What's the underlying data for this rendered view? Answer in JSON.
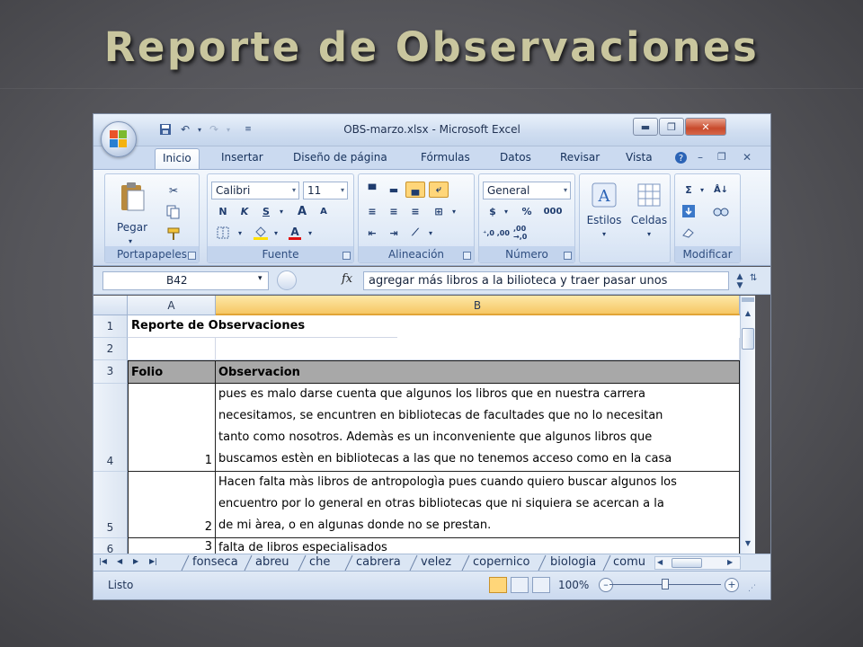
{
  "slide": {
    "title": "Reporte de Observaciones"
  },
  "window": {
    "title": "OBS-marzo.xlsx - Microsoft Excel",
    "min_label": "▬",
    "max_label": "❐",
    "close_label": "✕"
  },
  "tabs": [
    "Inicio",
    "Insertar",
    "Diseño de página",
    "Fórmulas",
    "Datos",
    "Revisar",
    "Vista"
  ],
  "ribbon": {
    "clipboard": {
      "label": "Portapapeles",
      "paste": "Pegar"
    },
    "font": {
      "label": "Fuente",
      "name": "Calibri",
      "size": "11",
      "bold": "N",
      "italic": "K",
      "underline": "S",
      "grow": "A",
      "shrink": "A"
    },
    "alignment": {
      "label": "Alineación"
    },
    "number": {
      "label": "Número",
      "format": "General",
      "currency": "$",
      "percent": "%",
      "thousands": "000",
      "inc_decimals": "⁺,0 ,00",
      "dec_decimals": ",00 →,0"
    },
    "styles": {
      "label": "Estilos"
    },
    "cells": {
      "label": "Celdas"
    },
    "editing": {
      "label": "Modificar",
      "sum": "Σ",
      "sort": "Å↓"
    }
  },
  "formula_bar": {
    "name_box": "B42",
    "fx": "fx",
    "value": "agregar más libros a la bilioteca y traer pasar unos"
  },
  "sheet": {
    "columns": [
      "A",
      "B"
    ],
    "row_numbers": [
      "1",
      "2",
      "3",
      "4",
      "5",
      "6"
    ],
    "title_cell": "Reporte de Observaciones",
    "headers": {
      "a": "Folio",
      "b": "Observacion"
    },
    "rows": [
      {
        "folio": "1",
        "text": "pues es malo darse cuenta que algunos los libros que en nuestra carrera\nnecesitamos, se encuntren en bibliotecas de facultades que no lo necesitan\ntanto como nosotros. Ademàs es un inconveniente que algunos libros que\nbuscamos estèn en bibliotecas a las que no tenemos acceso como en la casa"
      },
      {
        "folio": "2",
        "text": "Hacen falta màs libros de antropologìa pues cuando quiero buscar algunos los\nencuentro por lo general en otras bibliotecas que ni siquiera se acercan a la\nde mi àrea, o en algunas donde no se prestan."
      },
      {
        "folio": "3",
        "text": "falta de libros especialisados"
      }
    ]
  },
  "sheet_tabs": [
    "fonseca",
    "abreu",
    "che",
    "cabrera",
    "velez",
    "copernico",
    "biologia",
    "comu"
  ],
  "status": {
    "text": "Listo",
    "zoom": "100%"
  },
  "colors": {
    "accent": "#f6c764",
    "title_gold": "#c9c69e",
    "ribbon_blue": "#dde8f6"
  }
}
